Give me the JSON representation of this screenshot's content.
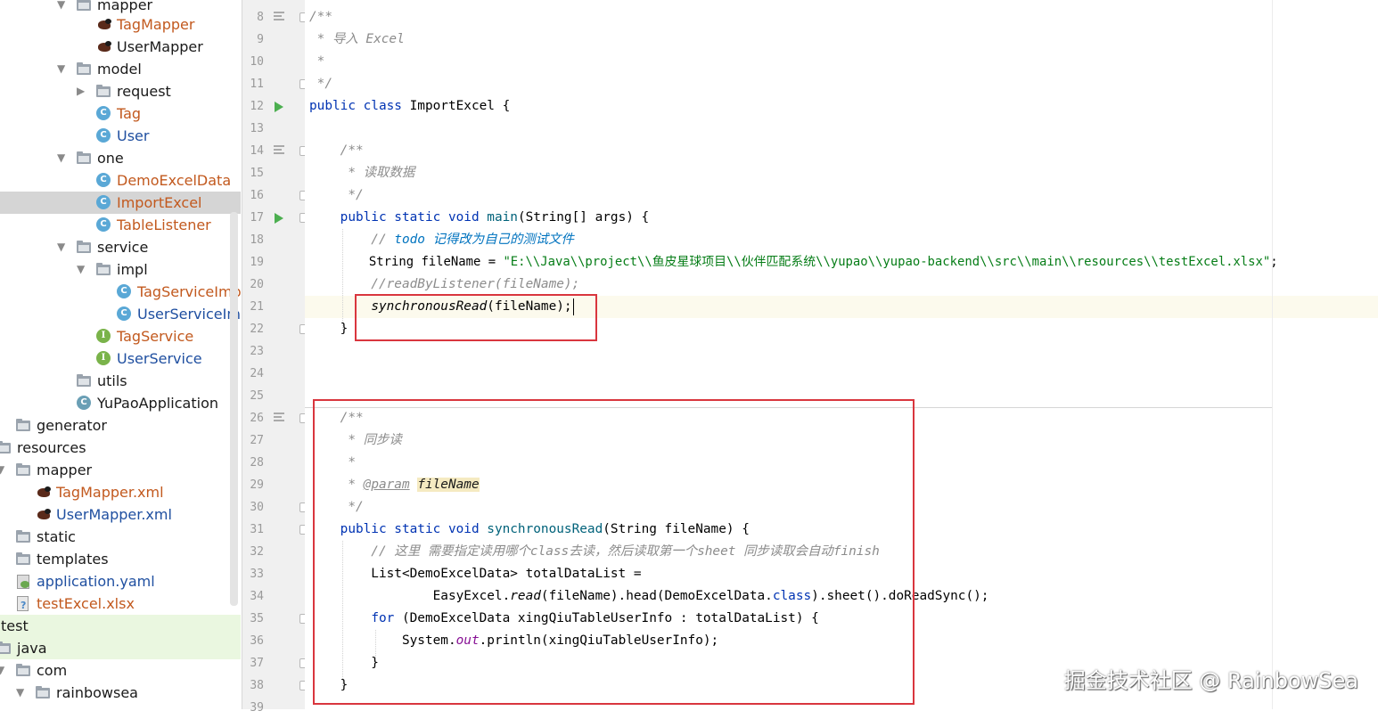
{
  "project_tree": [
    {
      "label": "mapper",
      "icon": "folder-icon",
      "expanded": true,
      "color": "black"
    },
    {
      "label": "TagMapper",
      "icon": "mybatis-bird-icon",
      "color": "orange"
    },
    {
      "label": "UserMapper",
      "icon": "mybatis-bird-icon",
      "color": "black"
    },
    {
      "label": "model",
      "icon": "folder-icon",
      "expanded": true,
      "color": "black"
    },
    {
      "label": "request",
      "icon": "folder-icon",
      "expanded": false,
      "color": "black"
    },
    {
      "label": "Tag",
      "icon": "class-icon",
      "color": "orange"
    },
    {
      "label": "User",
      "icon": "class-icon",
      "color": "blue"
    },
    {
      "label": "one",
      "icon": "folder-icon",
      "expanded": true,
      "color": "black"
    },
    {
      "label": "DemoExcelData",
      "icon": "class-icon",
      "color": "orange"
    },
    {
      "label": "ImportExcel",
      "icon": "runnable-class-icon",
      "color": "orange",
      "selected": true
    },
    {
      "label": "TableListener",
      "icon": "class-icon",
      "color": "orange"
    },
    {
      "label": "service",
      "icon": "folder-icon",
      "expanded": true,
      "color": "black"
    },
    {
      "label": "impl",
      "icon": "folder-icon",
      "expanded": true,
      "color": "black"
    },
    {
      "label": "TagServiceImpl",
      "icon": "class-icon",
      "color": "orange"
    },
    {
      "label": "UserServiceImpl",
      "icon": "class-icon",
      "color": "blue"
    },
    {
      "label": "TagService",
      "icon": "interface-icon",
      "color": "orange"
    },
    {
      "label": "UserService",
      "icon": "interface-icon",
      "color": "blue"
    },
    {
      "label": "utils",
      "icon": "folder-icon",
      "color": "black"
    },
    {
      "label": "YuPaoApplication",
      "icon": "spring-boot-class-icon",
      "color": "black"
    },
    {
      "label": "generator",
      "icon": "folder-icon",
      "color": "black"
    },
    {
      "label": "resources",
      "icon": "resources-folder-icon",
      "color": "black"
    },
    {
      "label": "mapper",
      "icon": "folder-icon",
      "expanded": true,
      "color": "black"
    },
    {
      "label": "TagMapper.xml",
      "icon": "mybatis-bird-icon",
      "color": "orange"
    },
    {
      "label": "UserMapper.xml",
      "icon": "mybatis-bird-icon",
      "color": "blue"
    },
    {
      "label": "static",
      "icon": "folder-icon",
      "color": "black"
    },
    {
      "label": "templates",
      "icon": "folder-icon",
      "color": "black"
    },
    {
      "label": "application.yaml",
      "icon": "yaml-file-icon",
      "color": "blue"
    },
    {
      "label": "testExcel.xlsx",
      "icon": "unknown-file-icon",
      "color": "orange"
    },
    {
      "label": "test",
      "icon": "none",
      "color": "black",
      "green": true
    },
    {
      "label": "java",
      "icon": "test-folder-icon",
      "color": "black",
      "green": true
    },
    {
      "label": "com",
      "icon": "folder-icon",
      "expanded": true,
      "color": "black"
    },
    {
      "label": "rainbowsea",
      "icon": "folder-icon",
      "expanded": true,
      "color": "black"
    }
  ],
  "line_numbers": [
    "8",
    "9",
    "10",
    "11",
    "12",
    "13",
    "14",
    "15",
    "16",
    "17",
    "18",
    "19",
    "20",
    "21",
    "22",
    "23",
    "24",
    "25",
    "26",
    "27",
    "28",
    "29",
    "30",
    "31",
    "32",
    "33",
    "34",
    "35",
    "36",
    "37",
    "38",
    "39"
  ],
  "code": {
    "l8": "/**",
    "l9": " * 导入 Excel",
    "l10": " *",
    "l11": " */",
    "l12_kw": "public class",
    "l12_rest": " ImportExcel {",
    "l14": "    /**",
    "l15": "     * 读取数据",
    "l16": "     */",
    "l17_indent": "    ",
    "l17_kw": "public static void",
    "l17_fn": "main",
    "l17_rest": "(String[] args) {",
    "l18_pre": "        // ",
    "l18_todo": "todo 记得改为自己的测试文件",
    "l19_pre": "        String fileName = ",
    "l19_str": "\"E:\\\\Java\\\\project\\\\鱼皮星球项目\\\\伙伴匹配系统\\\\yupao\\\\yupao-backend\\\\src\\\\main\\\\resources\\\\testExcel.xlsx\"",
    "l19_end": ";",
    "l20": "        //readByListener(fileName);",
    "l21_indent": "        ",
    "l21_call": "synchronousRead",
    "l21_rest": "(fileName);",
    "l22": "    }",
    "l26": "    /**",
    "l27": "     * 同步读",
    "l28": "     *",
    "l29_pre": "     * ",
    "l29_tag": "@param",
    "l29_param": "fileName",
    "l30": "     */",
    "l31_indent": "    ",
    "l31_kw": "public static void",
    "l31_fn": "synchronousRead",
    "l31_rest": "(String fileName) {",
    "l32": "        // 这里 需要指定读用哪个class去读，然后读取第一个sheet 同步读取会自动finish",
    "l33": "        List<DemoExcelData> totalDataList =",
    "l34_pre": "                EasyExcel.",
    "l34_read": "read",
    "l34_mid": "(fileName).head(DemoExcelData.",
    "l34_kw": "class",
    "l34_end": ").sheet().doReadSync();",
    "l35_indent": "        ",
    "l35_kw": "for",
    "l35_rest": " (DemoExcelData xingQiuTableUserInfo : totalDataList) {",
    "l36_pre": "            System.",
    "l36_out": "out",
    "l36_rest": ".println(xingQiuTableUserInfo);",
    "l37": "        }",
    "l38": "    }"
  },
  "watermark": "掘金技术社区 @ RainbowSea",
  "colors": {
    "keyword": "#0033b3",
    "comment": "#8c8c8c",
    "string": "#067d17",
    "method": "#00627a",
    "todo": "#0073bf",
    "field": "#871094",
    "highlight_box": "#d9363e",
    "tree_orange": "#c2591e",
    "tree_blue": "#1f4fa0"
  }
}
